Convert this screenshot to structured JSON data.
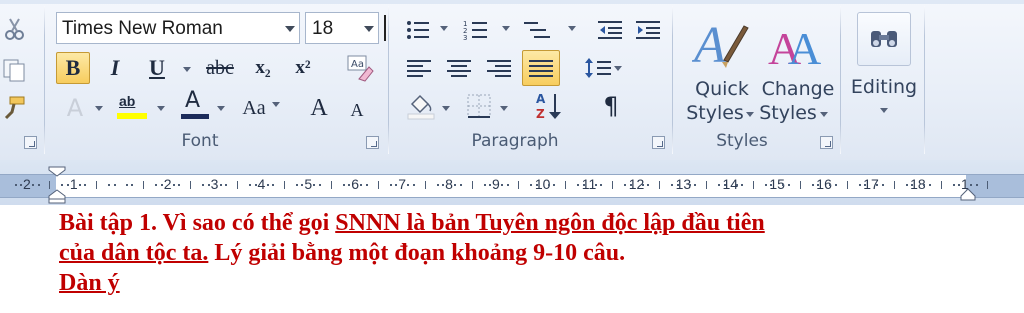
{
  "ribbon": {
    "font": {
      "name": "Times New Roman",
      "size": "18",
      "group_label": "Font",
      "bold": "B",
      "italic": "I",
      "underline": "U",
      "strikethrough": "abc",
      "subscript": "x₂",
      "superscript": "x²",
      "grow": "A",
      "shrink": "A",
      "change_case": "Aa",
      "highlight": "ab",
      "font_color": "A",
      "text_effects": "A"
    },
    "paragraph": {
      "group_label": "Paragraph",
      "sort": "A Z",
      "show_marks": "¶"
    },
    "styles": {
      "group_label": "Styles",
      "quick_styles": "Quick\nStyles",
      "quick_styles_line1": "Quick",
      "quick_styles_line2": "Styles",
      "change_styles_line1": "Change",
      "change_styles_line2": "Styles"
    },
    "editing": {
      "label": "Editing"
    }
  },
  "ruler": {
    "labels": [
      "2",
      "1",
      "1",
      "2",
      "3",
      "4",
      "5",
      "6",
      "7",
      "8",
      "9",
      "10",
      "11",
      "12",
      "13",
      "14",
      "15",
      "16",
      "17",
      "18",
      "1"
    ]
  },
  "document": {
    "line1_pre": "Bài tập 1. Vì sao có thể gọi ",
    "line1_underlined": "SNNN là bản Tuyên ngôn độc lập đầu tiên",
    "line2_underlined": "của dân tộc ta.",
    "line2_post": " Lý giải bằng một đoạn khoảng 9-10 câu.",
    "line3_underlined": "Dàn ý"
  },
  "colors": {
    "doc_text": "#c00000",
    "ribbon_bg": "#e9eff8",
    "active_button": "#f7cd5e"
  }
}
